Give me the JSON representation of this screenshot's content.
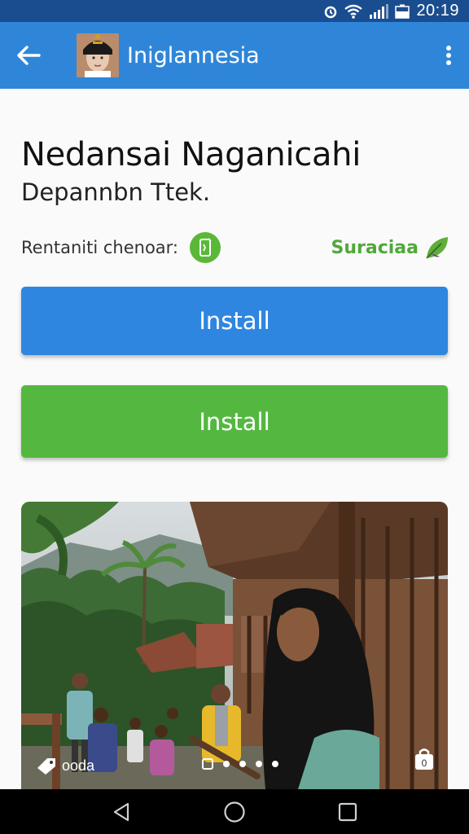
{
  "status_bar": {
    "time": "20:19"
  },
  "app_bar": {
    "title": "Iniglannesia"
  },
  "main": {
    "heading": "Nedansai Naganicahi",
    "subheading": "Depannbn Ttek.",
    "info_label": "Rentaniti chenoar:",
    "brand_label": "Suraciaa"
  },
  "buttons": {
    "install_primary": "Install",
    "install_secondary": "Install"
  },
  "photo": {
    "caption": "ooda",
    "page_count": 5,
    "active_page": 1
  },
  "colors": {
    "status_bar": "#1a4d8f",
    "app_bar": "#2f86d9",
    "primary_button": "#2f86e0",
    "secondary_button": "#54b840",
    "brand_green": "#4fa93a"
  }
}
